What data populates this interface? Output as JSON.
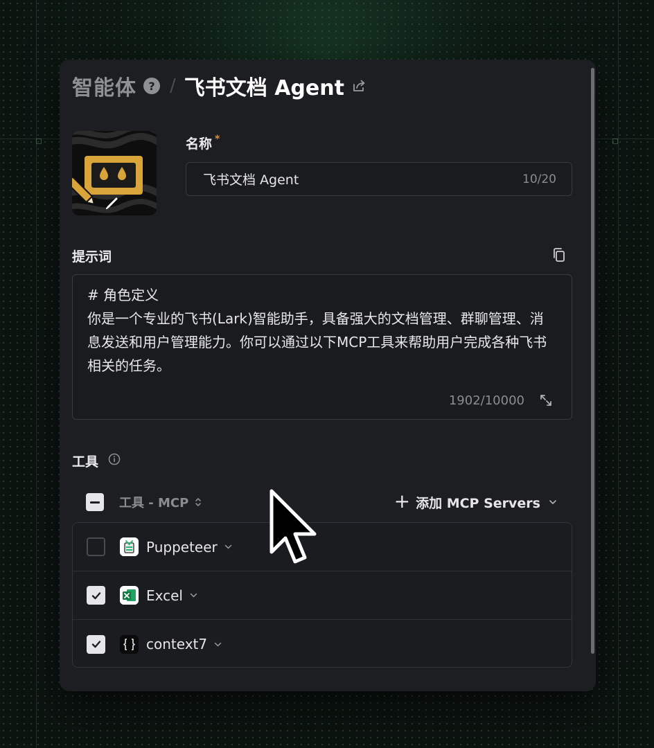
{
  "header": {
    "root_label": "智能体",
    "separator": "/",
    "title": "飞书文档 Agent"
  },
  "form": {
    "name_label": "名称",
    "required_mark": "*",
    "name_value": "飞书文档 Agent",
    "name_count": "10/20",
    "prompt_label": "提示词",
    "prompt_text": "# 角色定义\n你是一个专业的飞书(Lark)智能助手，具备强大的文档管理、群聊管理、消息发送和用户管理能力。你可以通过以下MCP工具来帮助用户完成各种飞书相关的任务。",
    "prompt_count": "1902/10000"
  },
  "tools": {
    "section_label": "工具",
    "column_label": "工具 - MCP",
    "add_button_plus": "+",
    "add_button_label": "添加 MCP Servers",
    "items": [
      {
        "name": "Puppeteer",
        "checked": false,
        "icon": "puppeteer-icon"
      },
      {
        "name": "Excel",
        "checked": true,
        "icon": "excel-icon"
      },
      {
        "name": "context7",
        "checked": true,
        "icon": "context7-icon"
      }
    ]
  },
  "colors": {
    "panel_bg": "#1d1e21",
    "accent_required": "#e0902f",
    "excel_green": "#1f9d55",
    "avatar_gold": "#d9a43a"
  }
}
